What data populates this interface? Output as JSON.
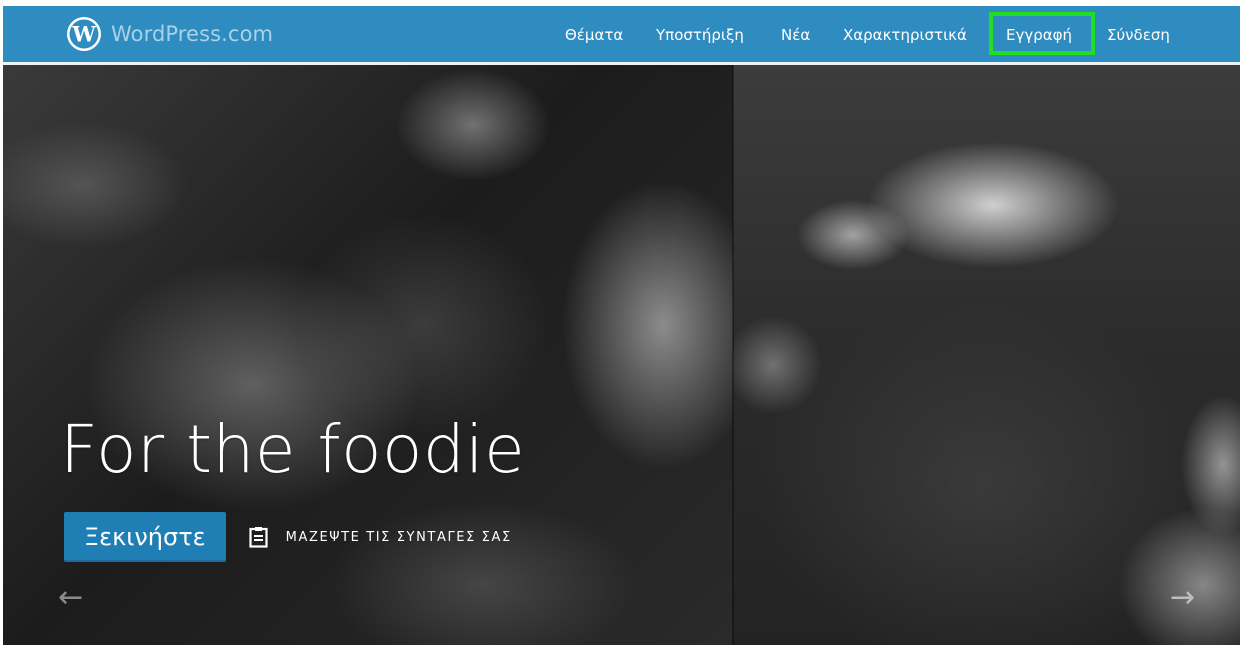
{
  "header": {
    "brand_name": "WordPress.com",
    "logo_icon": "wordpress-logo-icon",
    "background_color": "#2e8cc0",
    "nav": [
      {
        "id": "themes",
        "label": "Θέματα"
      },
      {
        "id": "support",
        "label": "Υποστήριξη"
      },
      {
        "id": "news",
        "label": "Νέα"
      },
      {
        "id": "features",
        "label": "Χαρακτηριστικά"
      },
      {
        "id": "signup",
        "label": "Εγγραφή",
        "highlighted": true
      },
      {
        "id": "login",
        "label": "Σύνδεση"
      }
    ],
    "highlight_color": "#22dd22"
  },
  "hero": {
    "title": "For the foodie",
    "cta_label": "Ξεκινήστε",
    "cta_color": "#1f7fb5",
    "tagline_icon": "clipboard-icon",
    "tagline": "ΜΑΖΕΨΤΕ ΤΙΣ ΣΥΝΤΑΓΕΣ ΣΑΣ",
    "prev_arrow": "←",
    "next_arrow": "→"
  }
}
